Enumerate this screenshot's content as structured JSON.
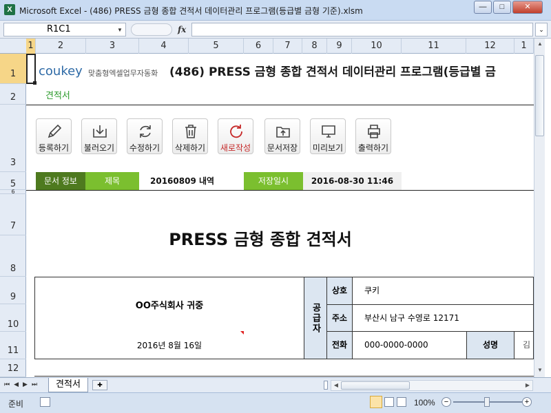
{
  "window": {
    "title": "Microsoft Excel - (486) PRESS 금형 종합 견적서 데이터관리 프로그램(등급별 금형 기준).xlsm",
    "app_icon": "X",
    "minimize": "—",
    "maximize": "□",
    "close": "✕"
  },
  "formula_bar": {
    "name_box": "R1C1",
    "fx": "fx",
    "formula": ""
  },
  "columns": [
    "1",
    "2",
    "3",
    "4",
    "5",
    "6",
    "7",
    "8",
    "9",
    "10",
    "11",
    "12",
    "1"
  ],
  "rows": [
    "1",
    "2",
    "3",
    "5",
    "6",
    "7",
    "8",
    "9",
    "10",
    "11",
    "12"
  ],
  "header": {
    "logo": "coukey",
    "logo_sub": "맞춤형엑셀업무자동화",
    "title": "(486) PRESS 금형 종합 견적서 데이터관리 프로그램(등급별 금",
    "subtitle": "견적서"
  },
  "toolbar": [
    {
      "label": "등록하기",
      "icon": "pencil-icon"
    },
    {
      "label": "불러오기",
      "icon": "download-icon"
    },
    {
      "label": "수정하기",
      "icon": "refresh-icon"
    },
    {
      "label": "삭제하기",
      "icon": "trash-icon"
    },
    {
      "label": "새로작성",
      "icon": "new-icon"
    },
    {
      "label": "문서저장",
      "icon": "folder-upload-icon"
    },
    {
      "label": "미리보기",
      "icon": "monitor-icon"
    },
    {
      "label": "출력하기",
      "icon": "printer-icon"
    }
  ],
  "doc_info": {
    "label": "문서 정보",
    "title_label": "제목",
    "title_value": "20160809 내역",
    "saved_label": "저장일시",
    "saved_value": "2016-08-30 11:46"
  },
  "estimate": {
    "heading": "PRESS 금형 종합 견적서",
    "recipient": "OO주식회사 귀중",
    "date": "2016년 8월 16일",
    "supplier_label": "공급자",
    "company_label": "상호",
    "company_value": "쿠키",
    "address_label": "주소",
    "address_value": "부산시 남구 수영로 12171",
    "phone_label": "전화",
    "phone_value": "000-0000-0000",
    "name_label": "성명",
    "name_value": "김"
  },
  "tabs": {
    "active": "견적서"
  },
  "status": {
    "ready": "준비",
    "zoom": "100%"
  }
}
